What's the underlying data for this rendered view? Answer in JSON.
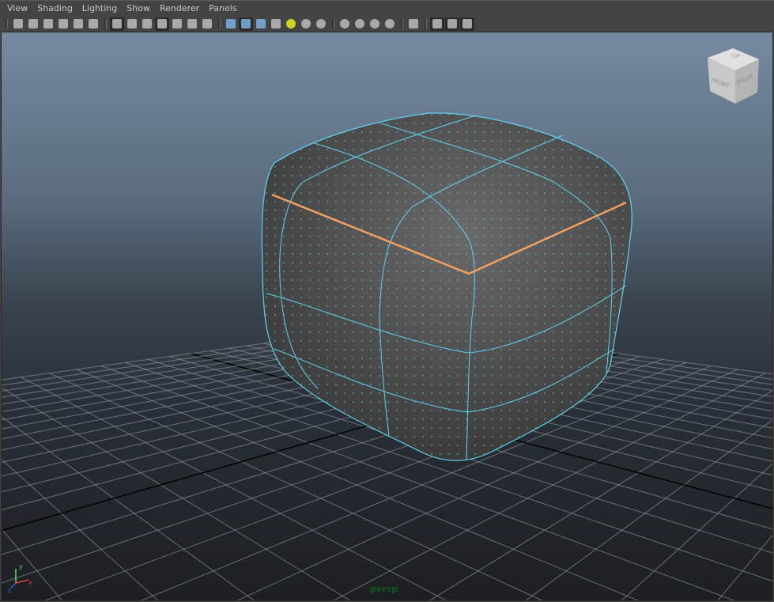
{
  "menus": [
    "View",
    "Shading",
    "Lighting",
    "Show",
    "Renderer",
    "Panels"
  ],
  "toolbar": [
    {
      "group": "camera",
      "icons": [
        "select-camera-icon",
        "camera-attributes-icon",
        "bookmarks-icon",
        "image-plane-icon",
        "2d-pan-zoom-icon",
        "grease-pencil-icon"
      ]
    },
    {
      "group": "display",
      "icons": [
        "grid-icon",
        "film-gate-icon",
        "resolution-gate-icon",
        "gate-mask-icon",
        "field-chart-icon",
        "safe-action-icon",
        "safe-title-icon"
      ]
    },
    {
      "group": "shading",
      "icons": [
        "wireframe-icon",
        "smooth-shade-icon",
        "wireframe-on-shaded-icon",
        "textured-icon",
        "use-all-lights-icon",
        "shadows-icon",
        "screen-space-ao-icon"
      ]
    },
    {
      "group": "effects",
      "icons": [
        "motion-blur-icon",
        "multisample-aa-icon",
        "depth-of-field-icon",
        "hardware-fog-icon"
      ]
    },
    {
      "group": "isolate",
      "icons": [
        "isolate-select-icon"
      ]
    },
    {
      "group": "xray",
      "icons": [
        "xray-icon",
        "xray-active-components-icon",
        "xray-joints-icon"
      ]
    }
  ],
  "viewcube": {
    "front": "FRONT",
    "right": "RIGHT",
    "top": "TOP"
  },
  "camera_label": "persp",
  "axis": {
    "x": "x",
    "y": "y",
    "z": "z"
  },
  "colors": {
    "wireframe": "#5fd3f0",
    "selected_edge": "#f0a060",
    "camera_label": "#0f5a1c"
  }
}
